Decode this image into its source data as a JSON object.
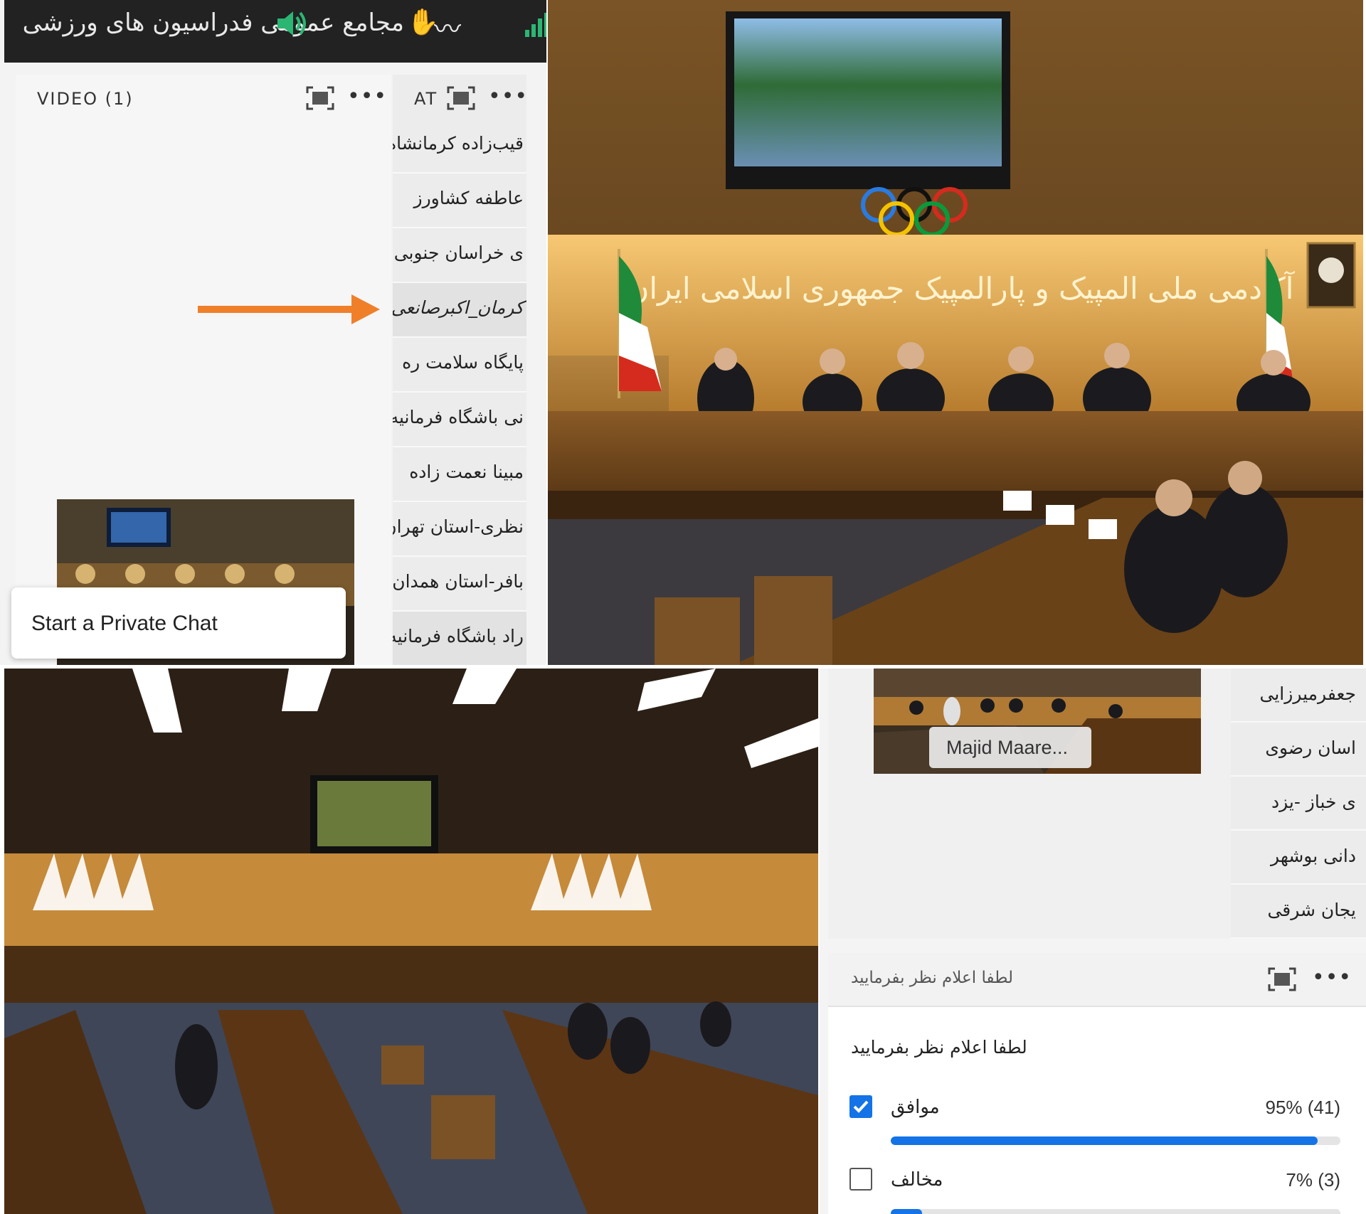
{
  "colors": {
    "accent": "#1473e6",
    "arrow": "#f07f2a",
    "header_bg": "#222222"
  },
  "top_app": {
    "meeting_title": "مجامع عمومی فدراسیون های ورزشی",
    "video_pod": {
      "label": "VIDEO (1)"
    },
    "attendee_pod": {
      "label": "AT",
      "items": [
        "قیب‌زاده کرمانشاه",
        "عاطفه کشاورز",
        "ی خراسان جنوبی",
        "کرمان_اکبرصانعی",
        "پایگاه سلامت ره",
        "نی باشگاه فرمانیه",
        "مبینا نعمت زاده",
        "نظری-استان تهران",
        "بافر-استان همدان",
        "راد باشگاه فرمانیه"
      ]
    },
    "context_menu": {
      "private_chat": "Start a Private Chat"
    }
  },
  "bottom_app": {
    "video_name_tag": "Majid Maare...",
    "attendees": [
      "جعفرمیرزایی",
      "اسان رضوی",
      "ی خباز -یزد",
      "دانی بوشهر",
      "یجان شرقی"
    ],
    "poll": {
      "header_title": "لطفا اعلام نظر بفرمایید",
      "question": "لطفا اعلام نظر بفرمایید",
      "options": [
        {
          "label": "موافق",
          "result": "95% (41)",
          "fraction": 0.95,
          "checked": true
        },
        {
          "label": "مخالف",
          "result": "7% (3)",
          "fraction": 0.07,
          "checked": false
        }
      ]
    }
  },
  "photos": {
    "wall_sign": "آکادمی ملی المپیک و پارالمپیک جمهوری اسلامی ایران"
  }
}
